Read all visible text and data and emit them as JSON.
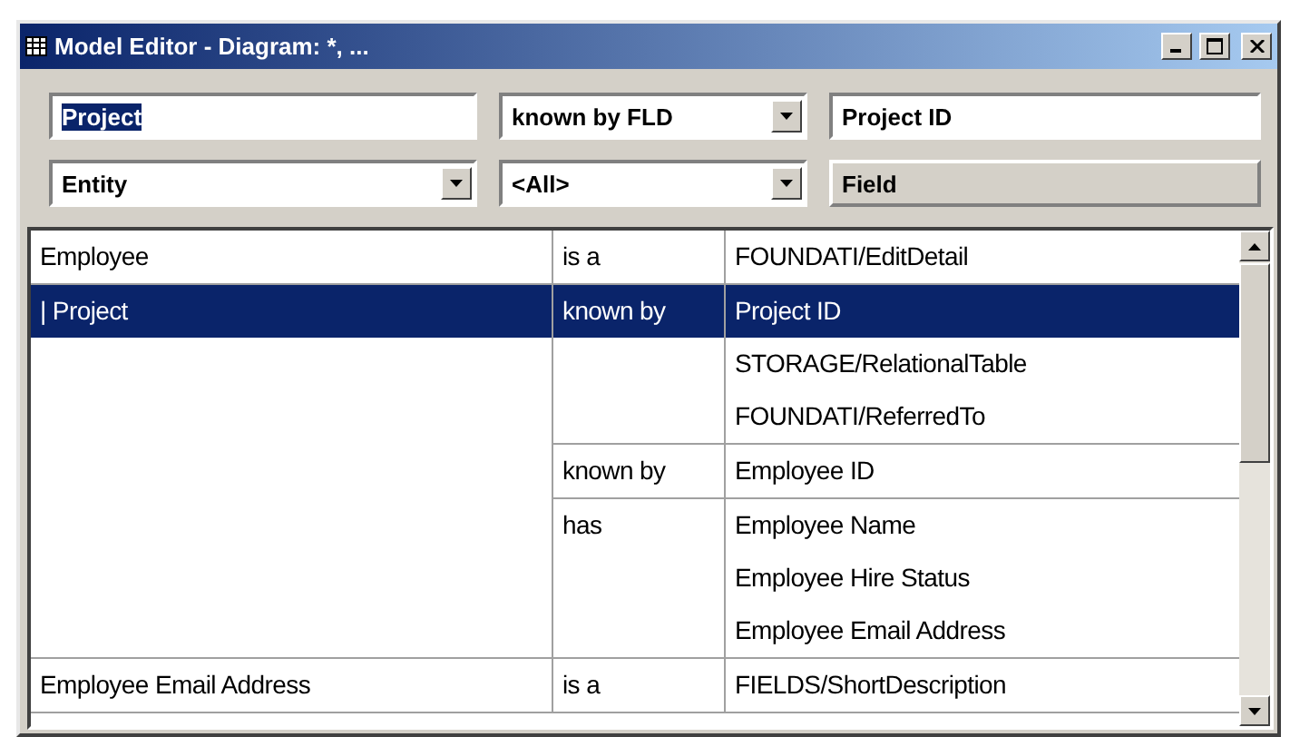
{
  "window": {
    "title": "Model Editor - Diagram: *, ..."
  },
  "query": {
    "subject": {
      "value": "Project",
      "selected_text": true
    },
    "relation": {
      "value": "known by FLD"
    },
    "target": {
      "value": "Project ID"
    },
    "subject_type": {
      "value": "Entity"
    },
    "relation_filter": {
      "value": "<All>"
    },
    "target_type": {
      "value": "Field"
    }
  },
  "table": {
    "groups": [
      {
        "subject": "Employee",
        "selected": false,
        "relations": [
          {
            "verb": "is a",
            "targets": [
              "FOUNDATI/EditDetail"
            ]
          }
        ]
      },
      {
        "subject": "| Project",
        "selected": true,
        "relations": [
          {
            "verb": "known by",
            "targets": [
              "Project ID",
              "STORAGE/RelationalTable",
              "FOUNDATI/ReferredTo"
            ]
          },
          {
            "verb": "known by",
            "targets": [
              "Employee ID"
            ]
          },
          {
            "verb": "has",
            "targets": [
              "Employee Name",
              "Employee Hire Status",
              "Employee Email Address"
            ]
          }
        ]
      },
      {
        "subject": "Employee Email Address",
        "selected": false,
        "relations": [
          {
            "verb": "is a",
            "targets": [
              "FIELDS/ShortDescription"
            ]
          }
        ]
      }
    ]
  }
}
